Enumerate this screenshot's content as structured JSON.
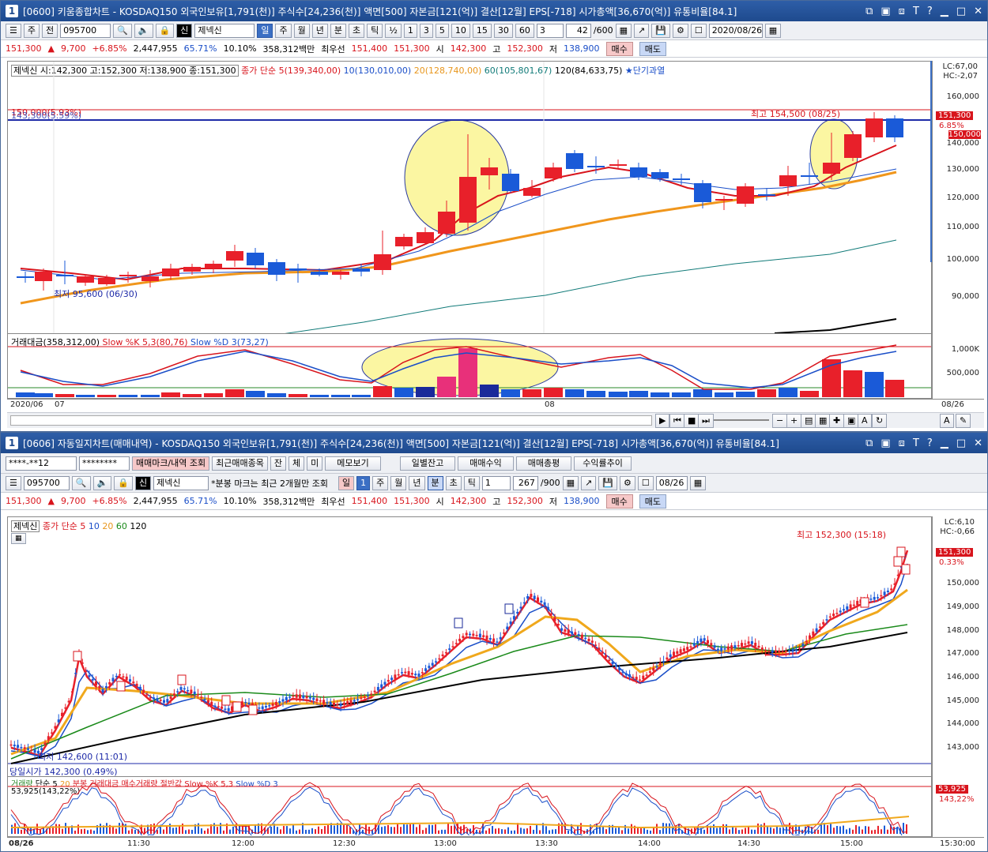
{
  "top": {
    "window_num": "1",
    "title": "[0600] 키움종합차트 - KOSDAQ150 외국인보유[1,791(천)] 주식수[24,236(천)] 액면[500] 자본금[121(억)] 결산[12월] EPS[-718] 시가총액[36,670(억)] 유통비율[84.1]",
    "toolbar": {
      "period_main": "주",
      "prev": "전",
      "code": "095700",
      "stock_name": "제넥신",
      "periods": [
        "일",
        "주",
        "월",
        "년",
        "분",
        "초",
        "틱"
      ],
      "sel_period": "일",
      "nums": [
        "½",
        "1",
        "3",
        "5",
        "10",
        "15",
        "30",
        "60",
        "3"
      ],
      "count": "42",
      "count_total": "/600",
      "date": "2020/08/26"
    },
    "price": {
      "cur": "151,300",
      "arrow": "▲",
      "chg": "9,700",
      "pct": "+6.85%",
      "vol": "2,447,955",
      "vol_pct": "65.71%",
      "turnover": "10.10%",
      "amount": "358,312백만",
      "best_label": "최우선",
      "ask": "151,400",
      "bid": "151,300",
      "open_label": "시",
      "open": "142,300",
      "high_label": "고",
      "high": "152,300",
      "low_label": "저",
      "low": "138,900",
      "buy": "매수",
      "sell": "매도"
    },
    "legend": {
      "ohlc": "제넥신 시:142,300 고:152,300 저:138,900 종:151,300",
      "ma_title": "종가 단순 5(139,340,00)",
      "ma10": "10(130,010,00)",
      "ma20": "20(128,740,00)",
      "ma60": "60(105,801,67)",
      "ma120": "120(84,633,75)",
      "star": "★단기과열"
    },
    "annotations": {
      "high": "최고 154,500 (08/25)",
      "low": "최저 95,600 (06/30)",
      "ref": "150,000(5.93%)",
      "ref2": "143,300(5.59%)"
    },
    "yaxis": [
      "160,000",
      "150,000",
      "140,000",
      "130,000",
      "120,000",
      "110,000",
      "100,000",
      "90,000"
    ],
    "lc": "LC:67,00",
    "hc": "HC:-2,07",
    "price_tag": "151,300",
    "pct_tag": "6.85%",
    "sub_legend": {
      "amount": "거래대금(358,312,00)",
      "k": "Slow %K 5,3(80,76)",
      "d": "Slow %D 3(73,27)"
    },
    "sub_axis": [
      "1,000K",
      "500,000"
    ],
    "xaxis": {
      "start": "2020/06",
      "m07": "07",
      "m08": "08",
      "end": "08/26"
    }
  },
  "bottom": {
    "window_num": "1",
    "title": "[0606] 자동일지차트(매매내역) - KOSDAQ150 외국인보유[1,791(천)] 주식수[24,236(천)] 액면[500] 자본금[121(억)] 결산[12월] EPS[-718] 시가총액[36,670(억)] 유통비율[84.1]",
    "tb1": {
      "account": "****-**12",
      "password": "********",
      "btn_mark": "매매마크/내역 조회",
      "btn_recent": "최근매매종목",
      "b_jan": "잔",
      "b_che": "체",
      "b_mi": "미",
      "btn_memo": "메모보기",
      "btn_daily": "일별잔고",
      "btn_profit": "매매수익",
      "btn_total": "매매총평",
      "btn_rate": "수익률추이"
    },
    "tb2": {
      "code": "095700",
      "stock_name": "제넥신",
      "note": "*분봉 마크는 최근 2개월만 조회",
      "period": "일",
      "period_num": "1",
      "periods": [
        "주",
        "월",
        "년",
        "분",
        "초",
        "틱"
      ],
      "tick_num": "1",
      "count": "267",
      "count_total": "/900",
      "date": "08/26"
    },
    "legend": {
      "name": "제넥신",
      "ma": "종가 단순 5",
      "m10": "10",
      "m20": "20",
      "m60": "60",
      "m120": "120"
    },
    "annotations": {
      "high": "최고 152,300 (15:18)",
      "low": "최저 142,600 (11:01)",
      "open": "당일시가 142,300 (0.49%)"
    },
    "yaxis": [
      "150,000",
      "149,000",
      "148,000",
      "147,000",
      "146,000",
      "145,000",
      "144,000",
      "143,000"
    ],
    "lc": "LC:6,10",
    "hc": "HC:-0,66",
    "price_tag": "151,300",
    "pct_tag": "0.33%",
    "sub_legend": {
      "vol": "거래량",
      "ma": "단순 5",
      "m20": "20",
      "minute": "분봉 거래대금",
      "buyvol": "매수거래량",
      "half": "절반값",
      "k": "Slow %K 5,3",
      "d": "Slow %D 3"
    },
    "sub_val": "53,925(143,22%)",
    "sub_tag1": "53,925",
    "sub_tag2": "143,22%",
    "xaxis": [
      "08/26",
      "11:30",
      "12:00",
      "12:30",
      "13:00",
      "13:30",
      "14:00",
      "14:30",
      "15:00"
    ],
    "xend": "15:30:00"
  }
}
